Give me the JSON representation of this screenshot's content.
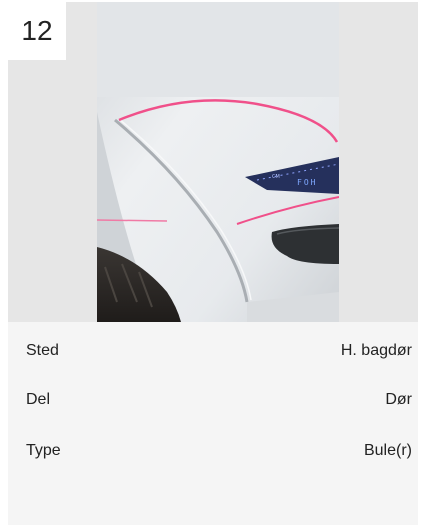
{
  "card": {
    "number": "12",
    "photo_icon": "car-door-damage-photo",
    "details": [
      {
        "label": "Sted",
        "value": "H. bagdør"
      },
      {
        "label": "Del",
        "value": "Dør"
      },
      {
        "label": "Type",
        "value": "Bule(r)"
      }
    ]
  },
  "colors": {
    "card_background": "#efefef",
    "details_background": "#f5f5f5",
    "marker_pink": "#f0508a",
    "car_white": "#eceff1"
  }
}
